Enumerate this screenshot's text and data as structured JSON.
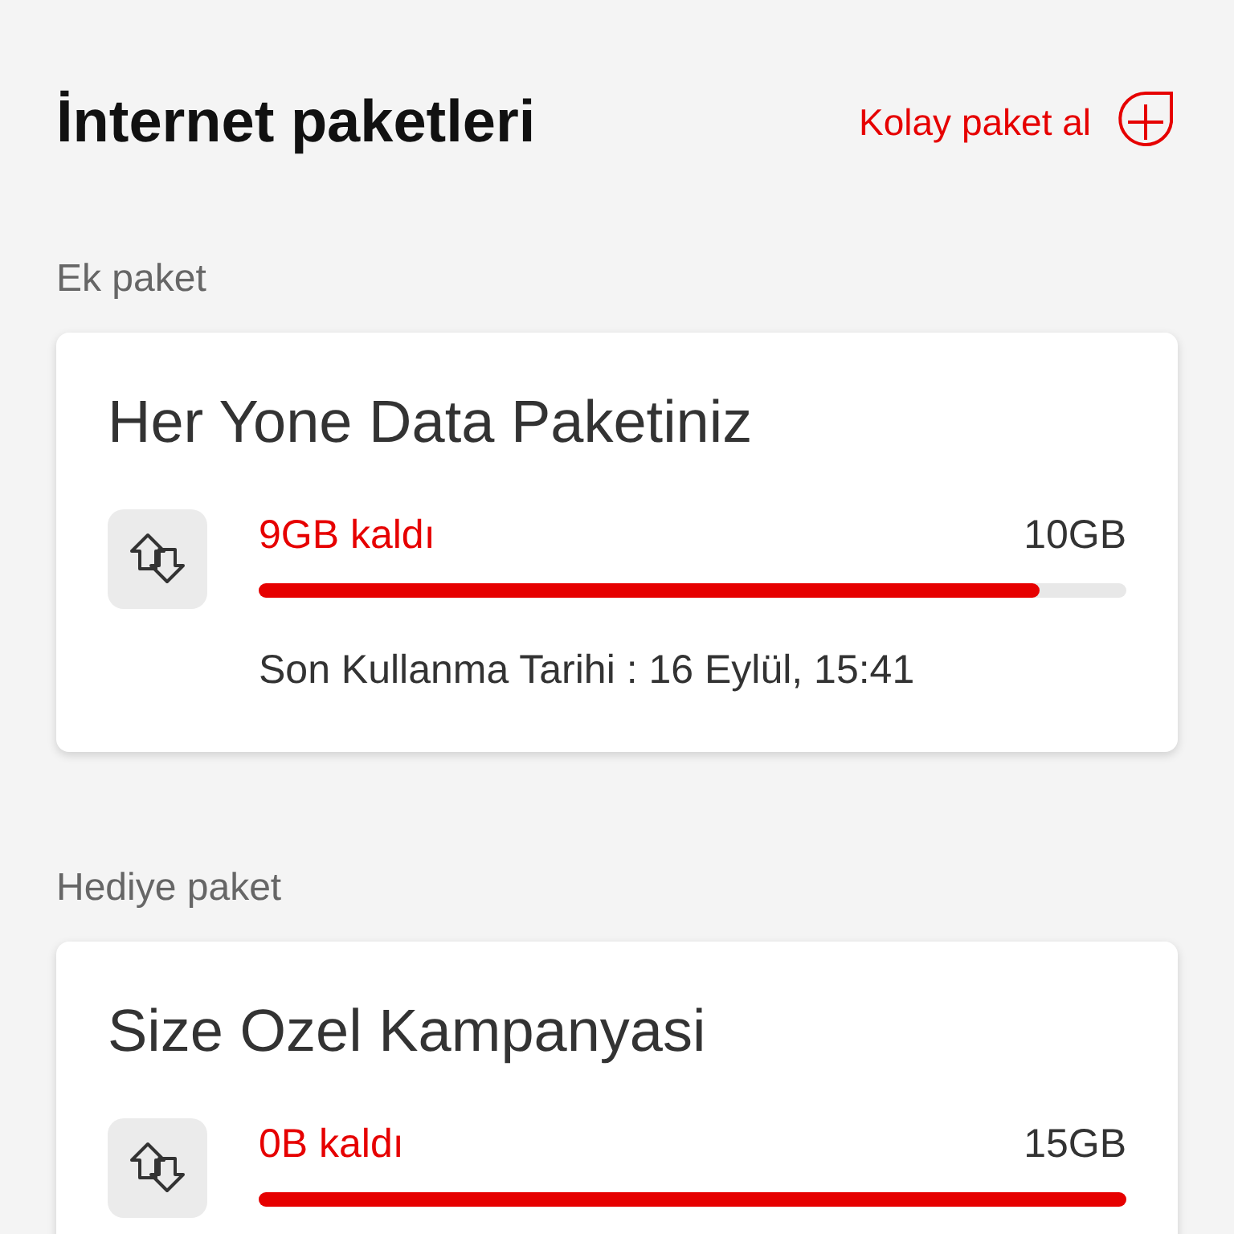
{
  "header": {
    "title": "İnternet paketleri",
    "action": "Kolay paket al"
  },
  "sections": [
    {
      "heading": "Ek paket",
      "card": {
        "title": "Her Yone Data Paketiniz",
        "remaining": "9GB kaldı",
        "total": "10GB",
        "level": 0.9,
        "expiry": "Son Kullanma Tarihi : 16 Eylül, 15:41"
      }
    },
    {
      "heading": "Hediye paket",
      "card": {
        "title": "Size Ozel Kampanyasi",
        "remaining": "0B kaldı",
        "total": "15GB",
        "level": 1
      }
    }
  ]
}
